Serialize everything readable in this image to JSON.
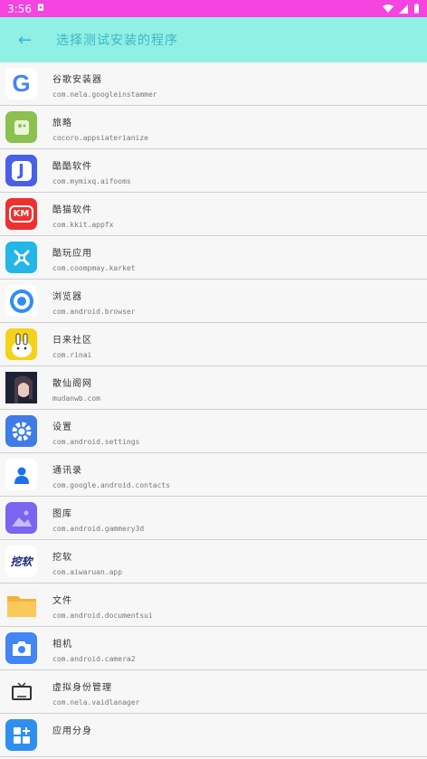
{
  "status_bar": {
    "time": "3:56",
    "shield": "◘"
  },
  "app_bar": {
    "title": "选择测试安装的程序",
    "back": "←"
  },
  "apps": [
    {
      "name": "谷歌安装器",
      "package": "com.nela.googleinstammer"
    },
    {
      "name": "旅略",
      "package": "cocoro.appsiaterianize"
    },
    {
      "name": "酷酷软件",
      "package": "com.mymixq.aifooms"
    },
    {
      "name": "酷猫软件",
      "package": "com.kkit.appfx"
    },
    {
      "name": "酷玩应用",
      "package": "com.coompmay.karket"
    },
    {
      "name": "浏览器",
      "package": "com.android.browser"
    },
    {
      "name": "日来社区",
      "package": "com.rinai"
    },
    {
      "name": "散仙阁网",
      "package": "mudanwb.com"
    },
    {
      "name": "设置",
      "package": "com.android.settings"
    },
    {
      "name": "通讯录",
      "package": "com.google.android.contacts"
    },
    {
      "name": "图库",
      "package": "com.android.gammery3d"
    },
    {
      "name": "挖软",
      "package": "com.aiwaruan.app"
    },
    {
      "name": "文件",
      "package": "com.android.documentsui"
    },
    {
      "name": "相机",
      "package": "com.android.camera2"
    },
    {
      "name": "虚拟身份管理",
      "package": "com.nela.vaidlanager"
    },
    {
      "name": "应用分身",
      "package": ""
    }
  ],
  "icons": {
    "google": "G",
    "kuku_soft": "J",
    "kumao_soft": "KM",
    "wa_ruan": "挖软"
  },
  "colors": {
    "status_bar": "#f544df",
    "app_bar": "#8ff0e3",
    "app_bar_text": "#3fb6c7"
  }
}
